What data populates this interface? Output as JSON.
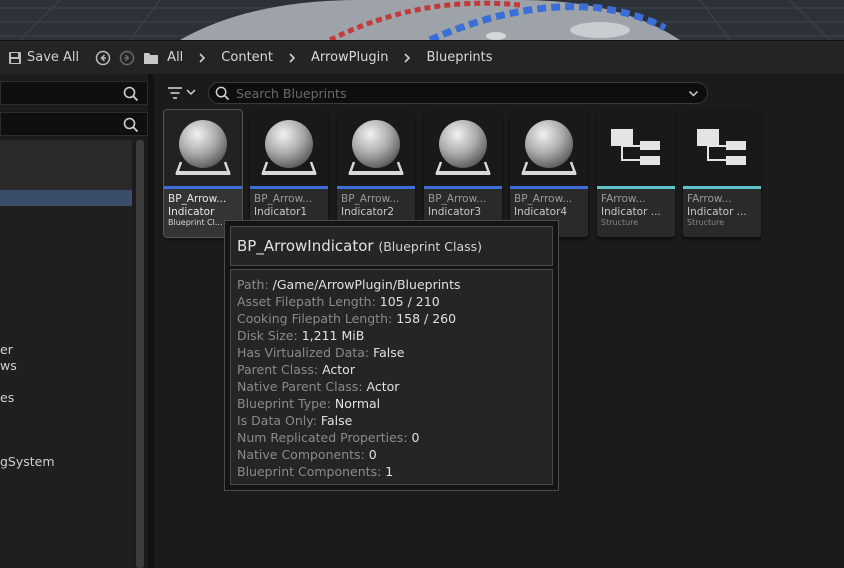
{
  "toolbar": {
    "save_all_label": "Save All",
    "breadcrumbs": [
      "All",
      "Content",
      "ArrowPlugin",
      "Blueprints"
    ]
  },
  "left_panel": {
    "tree_labels": [
      "er",
      "ws",
      "es",
      "gSystem"
    ]
  },
  "search": {
    "placeholder": "Search Blueprints"
  },
  "assets": [
    {
      "name_line1": "BP_Arrow...",
      "name_line2": "Indicator",
      "type": "Blueprint Cl...",
      "kind": "sphere",
      "accent": "#3d6fd6",
      "selected": true
    },
    {
      "name_line1": "BP_Arrow...",
      "name_line2": "Indicator1",
      "type": "",
      "kind": "sphere",
      "accent": "#3d6fd6",
      "selected": false
    },
    {
      "name_line1": "BP_Arrow...",
      "name_line2": "Indicator2",
      "type": "",
      "kind": "sphere",
      "accent": "#3d6fd6",
      "selected": false
    },
    {
      "name_line1": "BP_Arrow...",
      "name_line2": "Indicator3",
      "type": "",
      "kind": "sphere",
      "accent": "#3d6fd6",
      "selected": false
    },
    {
      "name_line1": "BP_Arrow...",
      "name_line2": "Indicator4",
      "type": "",
      "kind": "sphere",
      "accent": "#3d6fd6",
      "selected": false
    },
    {
      "name_line1": "FArrow...",
      "name_line2": "Indicator ...",
      "type": "Structure",
      "kind": "struct",
      "accent": "#5fc4c8",
      "selected": false
    },
    {
      "name_line1": "FArrow...",
      "name_line2": "Indicator ...",
      "type": "Structure",
      "kind": "struct",
      "accent": "#5fc4c8",
      "selected": false
    }
  ],
  "tooltip": {
    "title": "BP_ArrowIndicator",
    "subtitle": "(Blueprint Class)",
    "rows": [
      {
        "key": "Path:",
        "value": "/Game/ArrowPlugin/Blueprints"
      },
      {
        "key": "Asset Filepath Length:",
        "value": "105 / 210"
      },
      {
        "key": "Cooking Filepath Length:",
        "value": "158 / 260"
      },
      {
        "key": "Disk Size:",
        "value": "1,211 MiB"
      },
      {
        "key": "Has Virtualized Data:",
        "value": "False"
      },
      {
        "key": "Parent Class:",
        "value": "Actor"
      },
      {
        "key": "Native Parent Class:",
        "value": "Actor"
      },
      {
        "key": "Blueprint Type:",
        "value": "Normal"
      },
      {
        "key": "Is Data Only:",
        "value": "False"
      },
      {
        "key": "Num Replicated Properties:",
        "value": "0"
      },
      {
        "key": "Native Components:",
        "value": "0"
      },
      {
        "key": "Blueprint Components:",
        "value": "1"
      }
    ]
  },
  "colors": {
    "blueprint_accent": "#3d6fd6",
    "structure_accent": "#5fc4c8",
    "selection": "#3a4e6b"
  }
}
